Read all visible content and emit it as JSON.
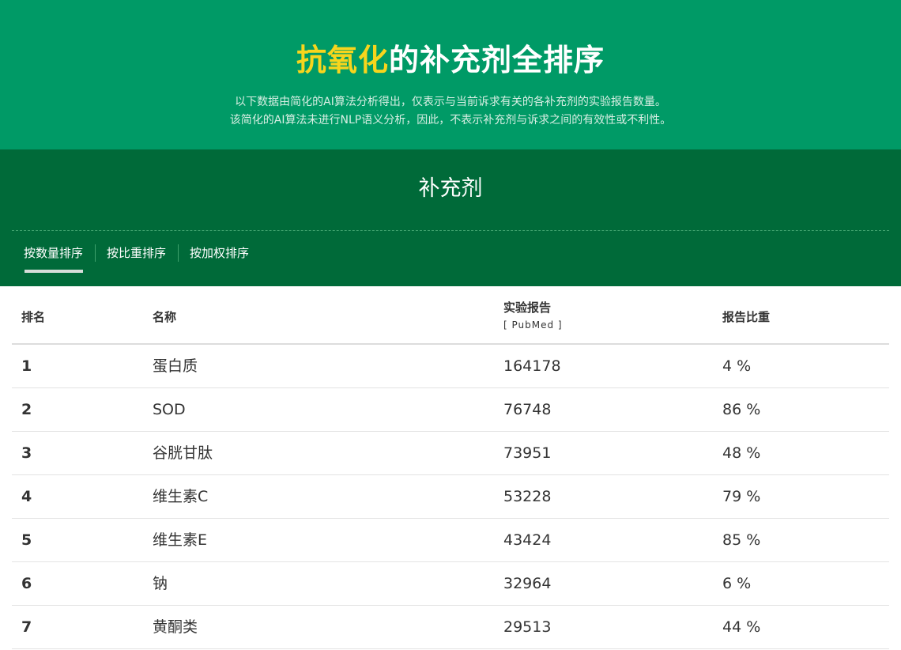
{
  "hero": {
    "title_highlight": "抗氧化",
    "title_rest": "的补充剂全排序",
    "desc_line1": "以下数据由简化的AI算法分析得出，仅表示与当前诉求有关的各补充剂的实验报告数量。",
    "desc_line2": "该简化的AI算法未进行NLP语义分析，因此，不表示补充剂与诉求之间的有效性或不利性。"
  },
  "section": {
    "title": "补充剂",
    "tabs": [
      "按数量排序",
      "按比重排序",
      "按加权排序"
    ],
    "active_tab": 0
  },
  "table": {
    "headers": {
      "rank": "排名",
      "name": "名称",
      "reports": "实验报告",
      "reports_sub": "[ PubMed ]",
      "ratio": "报告比重"
    },
    "rows": [
      {
        "rank": "1",
        "name": "蛋白质",
        "reports": "164178",
        "ratio": "4 %"
      },
      {
        "rank": "2",
        "name": "SOD",
        "reports": "76748",
        "ratio": "86 %"
      },
      {
        "rank": "3",
        "name": "谷胱甘肽",
        "reports": "73951",
        "ratio": "48 %"
      },
      {
        "rank": "4",
        "name": "维生素C",
        "reports": "53228",
        "ratio": "79 %"
      },
      {
        "rank": "5",
        "name": "维生素E",
        "reports": "43424",
        "ratio": "85 %"
      },
      {
        "rank": "6",
        "name": "钠",
        "reports": "32964",
        "ratio": "6 %"
      },
      {
        "rank": "7",
        "name": "黄酮类",
        "reports": "29513",
        "ratio": "44 %"
      }
    ]
  },
  "colors": {
    "hero_bg": "#009a66",
    "band_bg": "#006a39",
    "highlight": "#f7d51d"
  }
}
